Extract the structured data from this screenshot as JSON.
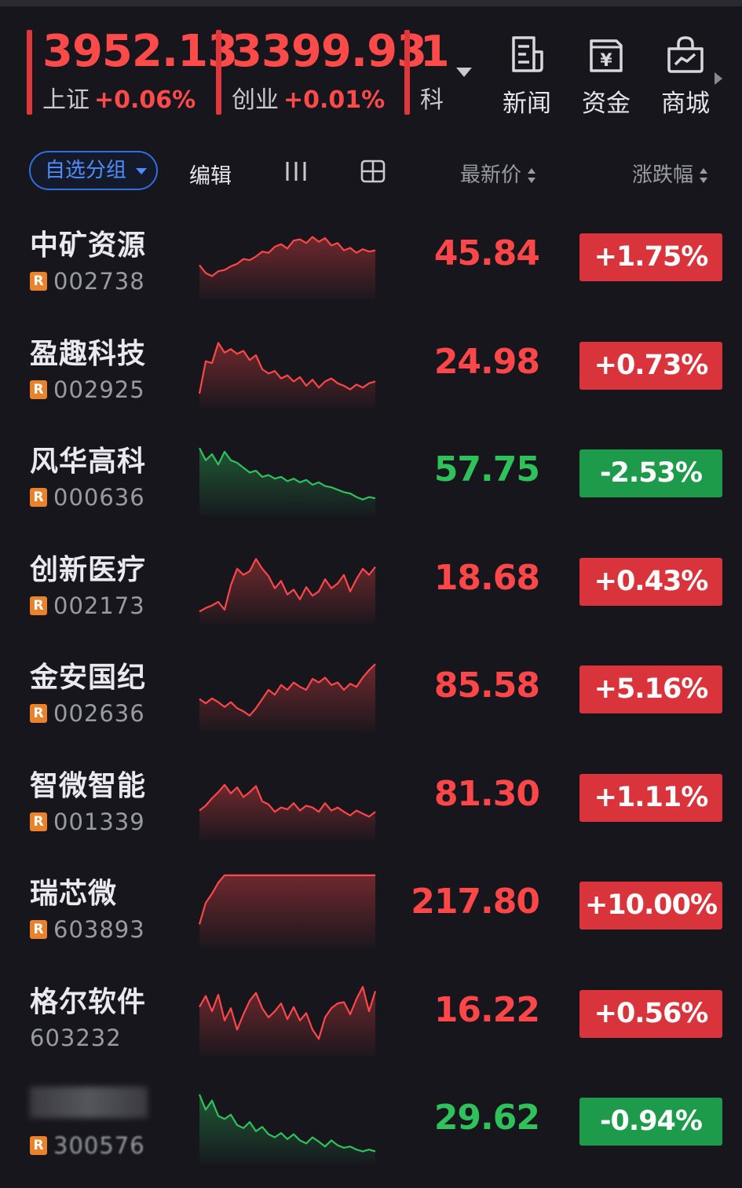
{
  "indices": [
    {
      "id": "sh",
      "value": "3952.13",
      "name": "上证",
      "change": "+0.06%"
    },
    {
      "id": "cy",
      "value": "3399.93",
      "name": "创业",
      "change": "+0.01%"
    },
    {
      "id": "ke",
      "value": "1",
      "name": "科",
      "change": ""
    }
  ],
  "tools": {
    "news": "新闻",
    "fund": "资金",
    "mall": "商城",
    "fund_symbol": "¥"
  },
  "header": {
    "group_label": "自选分组",
    "edit_label": "编辑",
    "price_label": "最新价",
    "change_label": "涨跌幅"
  },
  "colors": {
    "up": "#ff4648",
    "down": "#2fc25b",
    "accent": "#2f6fe0",
    "tag": "#e8822c",
    "background": "#16161c"
  },
  "stocks": [
    {
      "name": "中矿资源",
      "code": "002738",
      "tag": "R",
      "price": "45.84",
      "change": "+1.75%",
      "direction": "up",
      "spark": [
        0.38,
        0.25,
        0.2,
        0.28,
        0.3,
        0.36,
        0.4,
        0.48,
        0.46,
        0.52,
        0.6,
        0.58,
        0.68,
        0.72,
        0.65,
        0.78,
        0.8,
        0.74,
        0.84,
        0.76,
        0.82,
        0.7,
        0.74,
        0.62,
        0.66,
        0.58,
        0.64,
        0.6,
        0.62
      ]
    },
    {
      "name": "盈趣科技",
      "code": "002925",
      "tag": "R",
      "price": "24.98",
      "change": "+0.73%",
      "direction": "up",
      "spark": [
        0.05,
        0.58,
        0.55,
        0.88,
        0.72,
        0.78,
        0.7,
        0.75,
        0.6,
        0.68,
        0.45,
        0.38,
        0.42,
        0.3,
        0.35,
        0.25,
        0.32,
        0.18,
        0.28,
        0.15,
        0.25,
        0.3,
        0.22,
        0.18,
        0.12,
        0.2,
        0.15,
        0.22,
        0.25
      ]
    },
    {
      "name": "风华高科",
      "code": "000636",
      "tag": "R",
      "price": "57.75",
      "change": "-2.53%",
      "direction": "down",
      "spark": [
        0.92,
        0.72,
        0.82,
        0.65,
        0.86,
        0.72,
        0.68,
        0.6,
        0.52,
        0.55,
        0.45,
        0.48,
        0.42,
        0.45,
        0.38,
        0.42,
        0.36,
        0.4,
        0.32,
        0.36,
        0.3,
        0.28,
        0.24,
        0.2,
        0.18,
        0.12,
        0.08,
        0.12,
        0.1
      ]
    },
    {
      "name": "创新医疗",
      "code": "002173",
      "tag": "R",
      "price": "18.68",
      "change": "+0.43%",
      "direction": "up",
      "spark": [
        0.02,
        0.08,
        0.12,
        0.18,
        0.05,
        0.45,
        0.72,
        0.62,
        0.68,
        0.88,
        0.72,
        0.6,
        0.4,
        0.52,
        0.3,
        0.38,
        0.22,
        0.42,
        0.28,
        0.35,
        0.55,
        0.4,
        0.48,
        0.62,
        0.35,
        0.55,
        0.72,
        0.62,
        0.75
      ]
    },
    {
      "name": "金安国纪",
      "code": "002636",
      "tag": "R",
      "price": "85.58",
      "change": "+5.16%",
      "direction": "up",
      "spark": [
        0.35,
        0.28,
        0.36,
        0.3,
        0.22,
        0.3,
        0.2,
        0.15,
        0.08,
        0.2,
        0.35,
        0.5,
        0.42,
        0.58,
        0.5,
        0.62,
        0.55,
        0.5,
        0.68,
        0.62,
        0.7,
        0.58,
        0.62,
        0.5,
        0.6,
        0.55,
        0.7,
        0.82,
        0.92
      ]
    },
    {
      "name": "智微智能",
      "code": "001339",
      "tag": "R",
      "price": "81.30",
      "change": "+1.11%",
      "direction": "up",
      "spark": [
        0.3,
        0.38,
        0.5,
        0.6,
        0.72,
        0.58,
        0.68,
        0.52,
        0.6,
        0.7,
        0.45,
        0.4,
        0.28,
        0.35,
        0.32,
        0.42,
        0.3,
        0.38,
        0.35,
        0.28,
        0.42,
        0.3,
        0.35,
        0.28,
        0.22,
        0.3,
        0.25,
        0.2,
        0.28
      ]
    },
    {
      "name": "瑞芯微",
      "code": "603893",
      "tag": "R",
      "price": "217.80",
      "change": "+10.00%",
      "direction": "up",
      "spark": [
        0.2,
        0.55,
        0.7,
        0.88,
        1.0,
        1.0,
        1.0,
        1.0,
        1.0,
        1.0,
        1.0,
        1.0,
        1.0,
        1.0,
        1.0,
        1.0,
        1.0,
        1.0,
        1.0,
        1.0,
        1.0,
        1.0,
        1.0,
        1.0,
        1.0,
        1.0,
        1.0,
        1.0,
        1.0
      ]
    },
    {
      "name": "格尔软件",
      "code": "603232",
      "tag": "",
      "price": "16.22",
      "change": "+0.56%",
      "direction": "up",
      "spark": [
        0.62,
        0.8,
        0.55,
        0.82,
        0.4,
        0.6,
        0.25,
        0.5,
        0.72,
        0.85,
        0.6,
        0.45,
        0.55,
        0.68,
        0.42,
        0.62,
        0.4,
        0.52,
        0.25,
        0.1,
        0.45,
        0.6,
        0.68,
        0.7,
        0.5,
        0.75,
        0.95,
        0.55,
        0.88
      ]
    },
    {
      "name": "",
      "code": "300576",
      "tag": "R",
      "price": "29.62",
      "change": "-0.94%",
      "direction": "down",
      "blurred": true,
      "spark": [
        0.95,
        0.7,
        0.85,
        0.6,
        0.55,
        0.62,
        0.45,
        0.4,
        0.5,
        0.35,
        0.42,
        0.3,
        0.25,
        0.32,
        0.22,
        0.3,
        0.2,
        0.15,
        0.25,
        0.18,
        0.1,
        0.2,
        0.12,
        0.08,
        0.1,
        0.05,
        0.02,
        0.05,
        0.02
      ]
    }
  ]
}
